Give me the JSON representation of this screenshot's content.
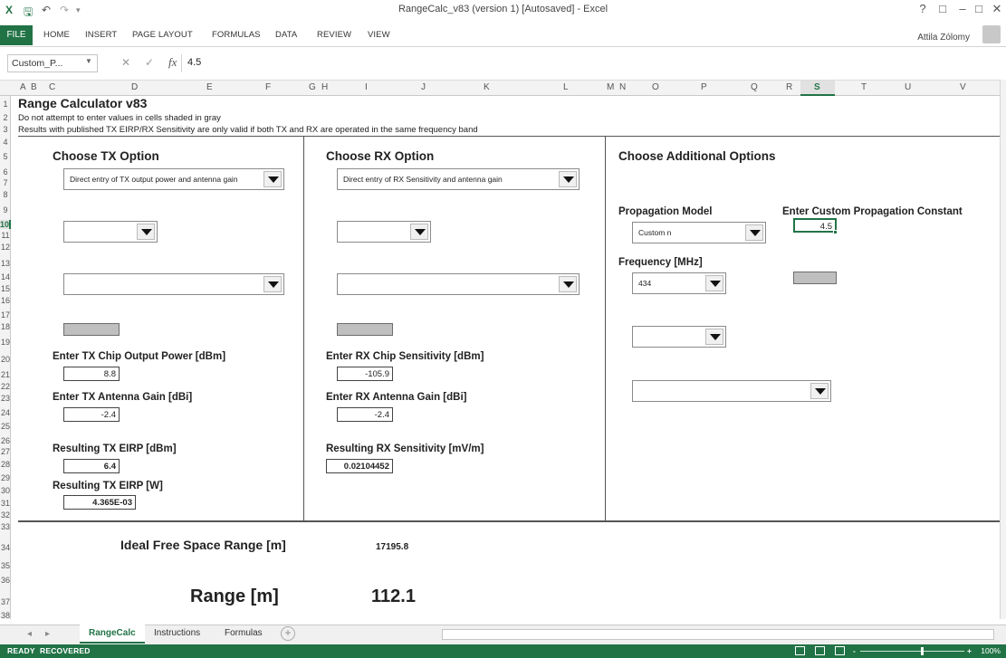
{
  "window": {
    "title": "RangeCalc_v83 (version 1) [Autosaved] - Excel",
    "user": "Attila Zólomy",
    "help": "?",
    "restore": "□",
    "minimize": "–",
    "close": "✕"
  },
  "quick_access": {
    "excel_icon": "X",
    "save": "🖫",
    "undo": "↶",
    "redo": "↷",
    "customize": "▾"
  },
  "ribbon": {
    "tabs": [
      "FILE",
      "HOME",
      "INSERT",
      "PAGE LAYOUT",
      "FORMULAS",
      "DATA",
      "REVIEW",
      "VIEW"
    ]
  },
  "formula_bar": {
    "name_box": "Custom_P...",
    "cancel": "✕",
    "enter": "✓",
    "fx": "fx",
    "value": "4.5"
  },
  "columns": [
    "A",
    "B",
    "C",
    "D",
    "E",
    "F",
    "G",
    "H",
    "I",
    "J",
    "K",
    "L",
    "M",
    "N",
    "O",
    "P",
    "Q",
    "R",
    "S",
    "T",
    "U",
    "V"
  ],
  "selected_column": "S",
  "rows": [
    "1",
    "2",
    "3",
    "4",
    "5",
    "6",
    "7",
    "8",
    "9",
    "10",
    "11",
    "12",
    "13",
    "14",
    "15",
    "16",
    "17",
    "18",
    "19",
    "20",
    "21",
    "22",
    "23",
    "24",
    "25",
    "26",
    "27",
    "28",
    "29",
    "30",
    "31",
    "32",
    "33",
    "34",
    "35",
    "36",
    "37",
    "38"
  ],
  "selected_row": "10",
  "sheet": {
    "title": "Range Calculator v83",
    "note1": "Do not attempt to enter values in cells shaded in gray",
    "note2": "Results with published TX EIRP/RX Sensitivity are only valid if both TX and RX are operated in the same frequency band",
    "tx": {
      "header": "Choose TX Option",
      "option": "Direct entry of TX output power and antenna gain",
      "chip_power_label": "Enter TX Chip Output Power [dBm]",
      "chip_power_value": "8.8",
      "antenna_gain_label": "Enter TX Antenna Gain [dBi]",
      "antenna_gain_value": "-2.4",
      "eirp_dbm_label": "Resulting TX EIRP [dBm]",
      "eirp_dbm_value": "6.4",
      "eirp_w_label": "Resulting TX EIRP [W]",
      "eirp_w_value": "4.365E-03"
    },
    "rx": {
      "header": "Choose RX Option",
      "option": "Direct entry of RX Sensitivity and antenna gain",
      "sensitivity_label": "Enter RX Chip Sensitivity [dBm]",
      "sensitivity_value": "-105.9",
      "antenna_gain_label": "Enter RX Antenna Gain [dBi]",
      "antenna_gain_value": "-2.4",
      "result_label": "Resulting RX Sensitivity [mV/m]",
      "result_value": "0.02104452"
    },
    "additional": {
      "header": "Choose Additional Options",
      "propagation_label": "Propagation Model",
      "propagation_value": "Custom n",
      "custom_constant_label": "Enter Custom Propagation Constant",
      "custom_constant_value": "4.5",
      "frequency_label": "Frequency [MHz]",
      "frequency_value": "434"
    },
    "results": {
      "ideal_label": "Ideal Free Space Range [m]",
      "ideal_value": "17195.8",
      "range_label": "Range [m]",
      "range_value": "112.1"
    }
  },
  "sheet_tabs": [
    "RangeCalc",
    "Instructions",
    "Formulas"
  ],
  "active_sheet_tab": "RangeCalc",
  "status": {
    "ready": "READY",
    "recovered": "RECOVERED",
    "zoom": "100%",
    "zoom_out": "-",
    "zoom_in": "+"
  },
  "colors": {
    "excel_green": "#217346",
    "gray_cell": "#bfbfbf"
  }
}
